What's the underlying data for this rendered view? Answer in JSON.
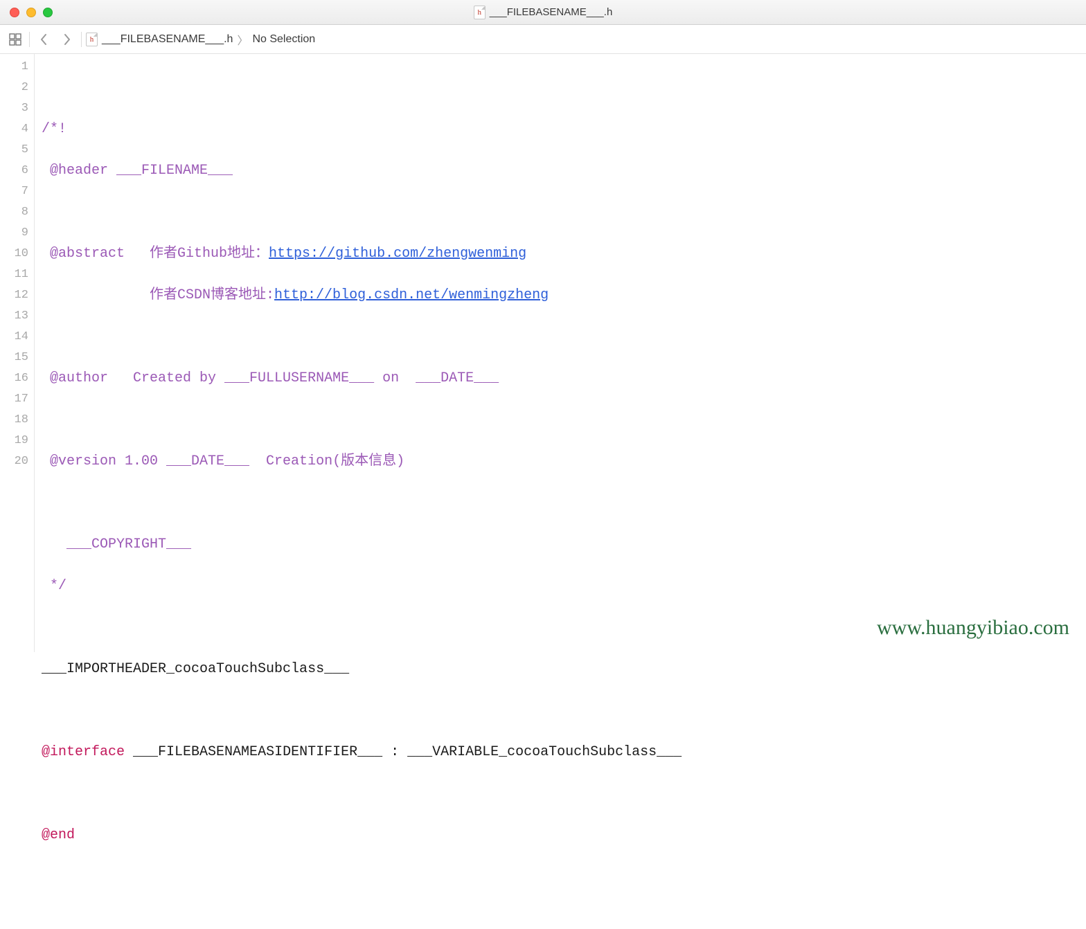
{
  "window": {
    "title": "___FILEBASENAME___.h"
  },
  "breadcrumb": {
    "file": "___FILEBASENAME___.h",
    "selection": "No Selection"
  },
  "code": {
    "l1": "",
    "l2": "/*!",
    "l3": " @header ___FILENAME___",
    "l4": "",
    "l5a": " @abstract   作者Github地址：",
    "l5b": "https://github.com/zhengwenming",
    "l6a": "             作者CSDN博客地址:",
    "l6b": "http://blog.csdn.net/wenmingzheng",
    "l7": "",
    "l8": " @author   Created by ___FULLUSERNAME___ on  ___DATE___",
    "l9": "",
    "l10": " @version 1.00 ___DATE___  Creation(版本信息)",
    "l11": "",
    "l12": "   ___COPYRIGHT___",
    "l13": " */",
    "l14": "",
    "l15": "___IMPORTHEADER_cocoaTouchSubclass___",
    "l16": "",
    "l17a": "@interface",
    "l17b": " ___FILEBASENAMEASIDENTIFIER___ : ___VARIABLE_cocoaTouchSubclass___",
    "l18": "",
    "l19": "@end",
    "l20": ""
  },
  "line_numbers": [
    "1",
    "2",
    "3",
    "4",
    "5",
    "6",
    "7",
    "8",
    "9",
    "10",
    "11",
    "12",
    "13",
    "14",
    "15",
    "16",
    "17",
    "18",
    "19",
    "20"
  ],
  "watermark": "www.huangyibiao.com"
}
